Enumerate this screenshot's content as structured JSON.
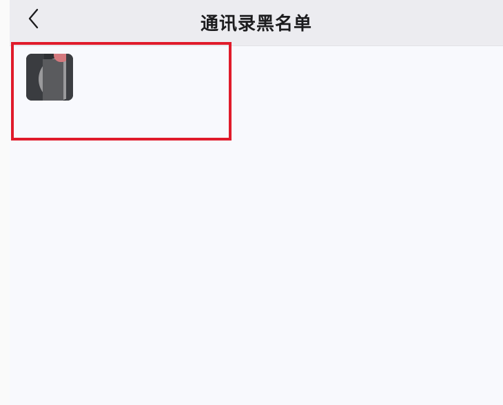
{
  "navbar": {
    "back_icon": "chevron-left-icon",
    "title": "通讯录黑名单"
  },
  "blacklist": {
    "items": [
      {
        "avatar_icon": "blurred-avatar-image",
        "highlight_color": "#e01b2b"
      }
    ]
  },
  "colors": {
    "navbar_background": "#ececf0",
    "page_background": "#f8f9fd",
    "highlight": "#e01b2b"
  }
}
